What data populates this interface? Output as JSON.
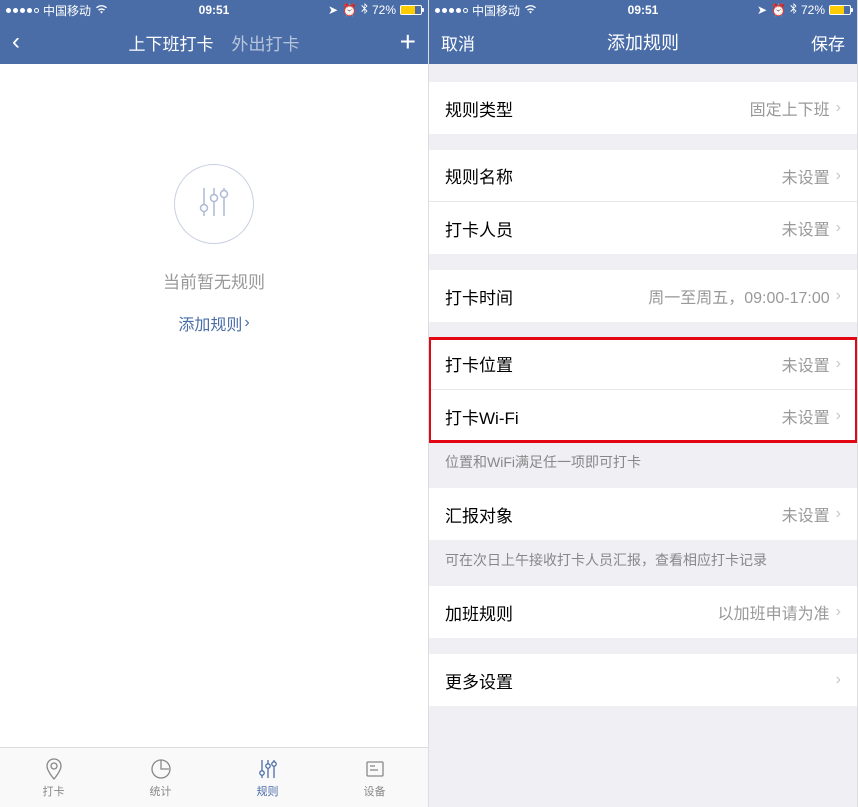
{
  "statusBar": {
    "carrier": "中国移动",
    "time": "09:51",
    "battery": "72%"
  },
  "left": {
    "nav": {
      "tab1": "上下班打卡",
      "tab2": "外出打卡"
    },
    "empty": {
      "text": "当前暂无规则",
      "link": "添加规则"
    },
    "tabbar": {
      "items": [
        {
          "label": "打卡"
        },
        {
          "label": "统计"
        },
        {
          "label": "规则"
        },
        {
          "label": "设备"
        }
      ]
    }
  },
  "right": {
    "nav": {
      "cancel": "取消",
      "title": "添加规则",
      "save": "保存"
    },
    "cells": {
      "ruleType": {
        "label": "规则类型",
        "value": "固定上下班"
      },
      "ruleName": {
        "label": "规则名称",
        "value": "未设置"
      },
      "members": {
        "label": "打卡人员",
        "value": "未设置"
      },
      "time": {
        "label": "打卡时间",
        "value": "周一至周五，09:00-17:00"
      },
      "location": {
        "label": "打卡位置",
        "value": "未设置"
      },
      "wifi": {
        "label": "打卡Wi-Fi",
        "value": "未设置"
      },
      "locWifiHint": "位置和WiFi满足任一项即可打卡",
      "report": {
        "label": "汇报对象",
        "value": "未设置"
      },
      "reportHint": "可在次日上午接收打卡人员汇报，查看相应打卡记录",
      "overtime": {
        "label": "加班规则",
        "value": "以加班申请为准"
      },
      "more": {
        "label": "更多设置",
        "value": ""
      }
    }
  }
}
